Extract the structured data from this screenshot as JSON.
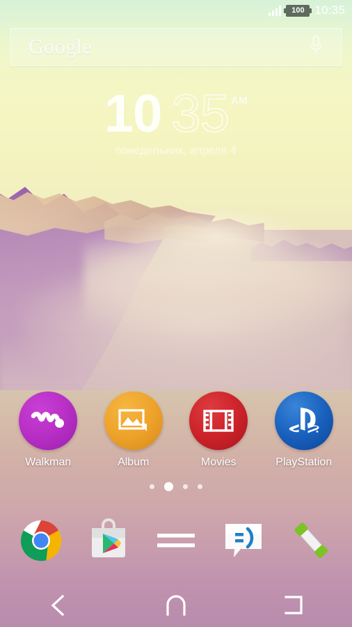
{
  "status_bar": {
    "signal_icon": "signal-bars-icon",
    "battery_level": "100",
    "time": "10:35"
  },
  "search": {
    "logo_text": "Google",
    "mic_icon": "microphone-icon",
    "placeholder": "Google"
  },
  "clock_widget": {
    "hour": "10",
    "minute": "35",
    "ampm": "AM",
    "date": "понедельник, апреля 4"
  },
  "apps": [
    {
      "label": "Walkman",
      "icon": "walkman-icon",
      "color": "#b62ec4"
    },
    {
      "label": "Album",
      "icon": "album-icon",
      "color": "#eda22a"
    },
    {
      "label": "Movies",
      "icon": "movies-icon",
      "color": "#cc2229"
    },
    {
      "label": "PlayStation",
      "icon": "playstation-icon",
      "color": "#1a63c0"
    }
  ],
  "page_indicator": {
    "total": 4,
    "active_index": 1
  },
  "dock": [
    {
      "name": "Chrome",
      "icon": "chrome-icon"
    },
    {
      "name": "Play Store",
      "icon": "play-store-icon"
    },
    {
      "name": "Apps",
      "icon": "app-drawer-icon"
    },
    {
      "name": "Messaging",
      "icon": "messaging-icon"
    },
    {
      "name": "Phone",
      "icon": "phone-icon"
    }
  ],
  "nav_bar": [
    {
      "name": "Back",
      "icon": "back-chevron-icon"
    },
    {
      "name": "Home",
      "icon": "home-arch-icon"
    },
    {
      "name": "Recents",
      "icon": "recents-bracket-icon"
    }
  ],
  "colors": {
    "status_text": "#ffffff",
    "battery_pill": "#5e6b5e",
    "label_text": "#ffffff"
  }
}
